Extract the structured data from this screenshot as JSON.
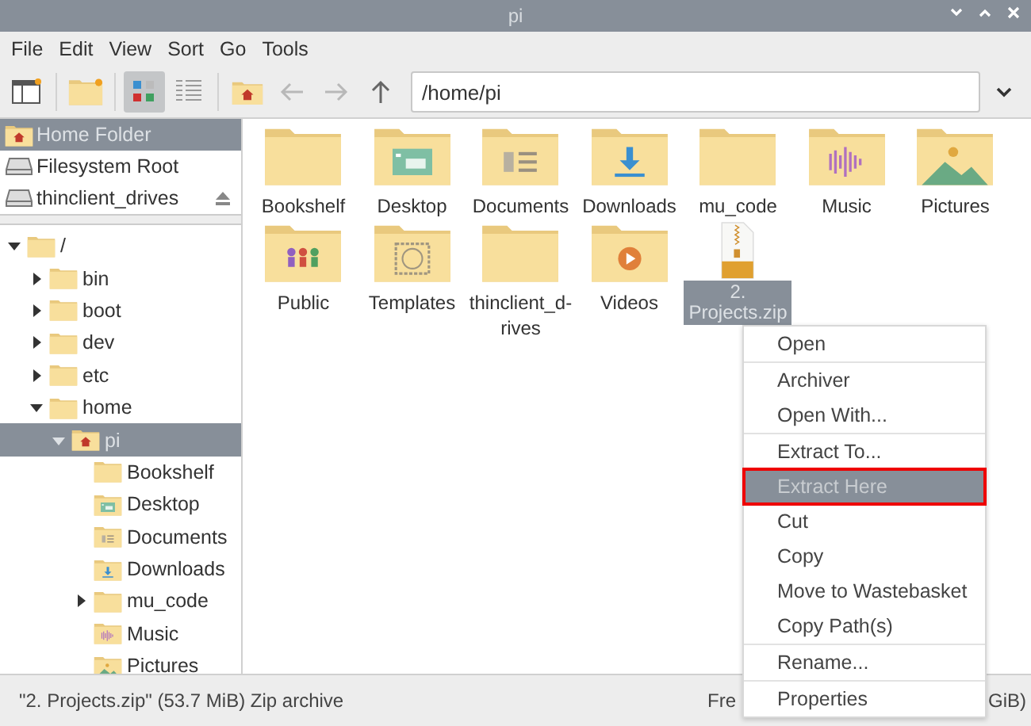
{
  "window": {
    "title": "pi"
  },
  "menu_bar": [
    "File",
    "Edit",
    "View",
    "Sort",
    "Go",
    "Tools"
  ],
  "toolbar": {
    "view_modes": [
      {
        "selected": true
      },
      {
        "selected": false
      }
    ],
    "back": {
      "disabled": true
    },
    "forward": {
      "disabled": true
    },
    "up": {
      "disabled": false
    },
    "path": "/home/pi"
  },
  "places": [
    {
      "label": "Home Folder",
      "selected": true,
      "kind": "home"
    },
    {
      "label": "Filesystem Root",
      "selected": false,
      "kind": "drive"
    },
    {
      "label": "thinclient_drives",
      "selected": false,
      "kind": "mount"
    }
  ],
  "tree": [
    {
      "label": "/",
      "expandable": true,
      "expanded": true,
      "selected": false,
      "children": [
        {
          "label": "bin",
          "expandable": true,
          "expanded": false,
          "selected": false
        },
        {
          "label": "boot",
          "expandable": true,
          "expanded": false,
          "selected": false
        },
        {
          "label": "dev",
          "expandable": true,
          "expanded": false,
          "selected": false
        },
        {
          "label": "etc",
          "expandable": true,
          "expanded": false,
          "selected": false
        },
        {
          "label": "home",
          "expandable": true,
          "expanded": true,
          "selected": false,
          "children": [
            {
              "label": "pi",
              "expandable": true,
              "expanded": true,
              "selected": true,
              "children": [
                {
                  "label": "Bookshelf",
                  "expandable": false,
                  "expanded": false,
                  "selected": false
                },
                {
                  "label": "Desktop",
                  "expandable": false,
                  "expanded": false,
                  "selected": false
                },
                {
                  "label": "Documents",
                  "expandable": false,
                  "expanded": false,
                  "selected": false
                },
                {
                  "label": "Downloads",
                  "expandable": false,
                  "expanded": false,
                  "selected": false
                },
                {
                  "label": "mu_code",
                  "expandable": true,
                  "expanded": false,
                  "selected": false
                },
                {
                  "label": "Music",
                  "expandable": false,
                  "expanded": false,
                  "selected": false
                },
                {
                  "label": "Pictures",
                  "expandable": false,
                  "expanded": false,
                  "selected": false
                }
              ]
            }
          ]
        }
      ]
    }
  ],
  "files": [
    {
      "name": "Bookshelf",
      "kind": "folder",
      "selected": false
    },
    {
      "name": "Desktop",
      "kind": "folder",
      "selected": false
    },
    {
      "name": "Documents",
      "kind": "folder",
      "selected": false
    },
    {
      "name": "Downloads",
      "kind": "folder",
      "selected": false
    },
    {
      "name": "mu_code",
      "kind": "folder",
      "selected": false
    },
    {
      "name": "Music",
      "kind": "folder",
      "selected": false
    },
    {
      "name": "Pictures",
      "kind": "folder",
      "selected": false
    },
    {
      "name": "Public",
      "kind": "folder",
      "selected": false
    },
    {
      "name": "Templates",
      "kind": "folder",
      "selected": false
    },
    {
      "name": "thinclient_d-rives",
      "kind": "folder",
      "selected": false
    },
    {
      "name": "Videos",
      "kind": "folder",
      "selected": false
    },
    {
      "name": "2. Projects.zip",
      "kind": "archive",
      "selected": true
    }
  ],
  "context_menu": [
    [
      {
        "label": "Open",
        "selected": false,
        "outlined": false
      }
    ],
    [
      {
        "label": "Archiver",
        "selected": false,
        "outlined": false
      },
      {
        "label": "Open With...",
        "selected": false,
        "outlined": false
      }
    ],
    [
      {
        "label": "Extract To...",
        "selected": false,
        "outlined": false
      },
      {
        "label": "Extract Here",
        "selected": true,
        "outlined": true
      },
      {
        "label": "Cut",
        "selected": false,
        "outlined": false
      },
      {
        "label": "Copy",
        "selected": false,
        "outlined": false
      },
      {
        "label": "Move to Wastebasket",
        "selected": false,
        "outlined": false
      },
      {
        "label": "Copy Path(s)",
        "selected": false,
        "outlined": false
      }
    ],
    [
      {
        "label": "Rename...",
        "selected": false,
        "outlined": false
      }
    ],
    [
      {
        "label": "Properties",
        "selected": false,
        "outlined": false
      }
    ]
  ],
  "status_bar": {
    "left": "\"2. Projects.zip\" (53.7 MiB) Zip archive",
    "right_start": "Fre",
    "right_end": "GiB)"
  }
}
